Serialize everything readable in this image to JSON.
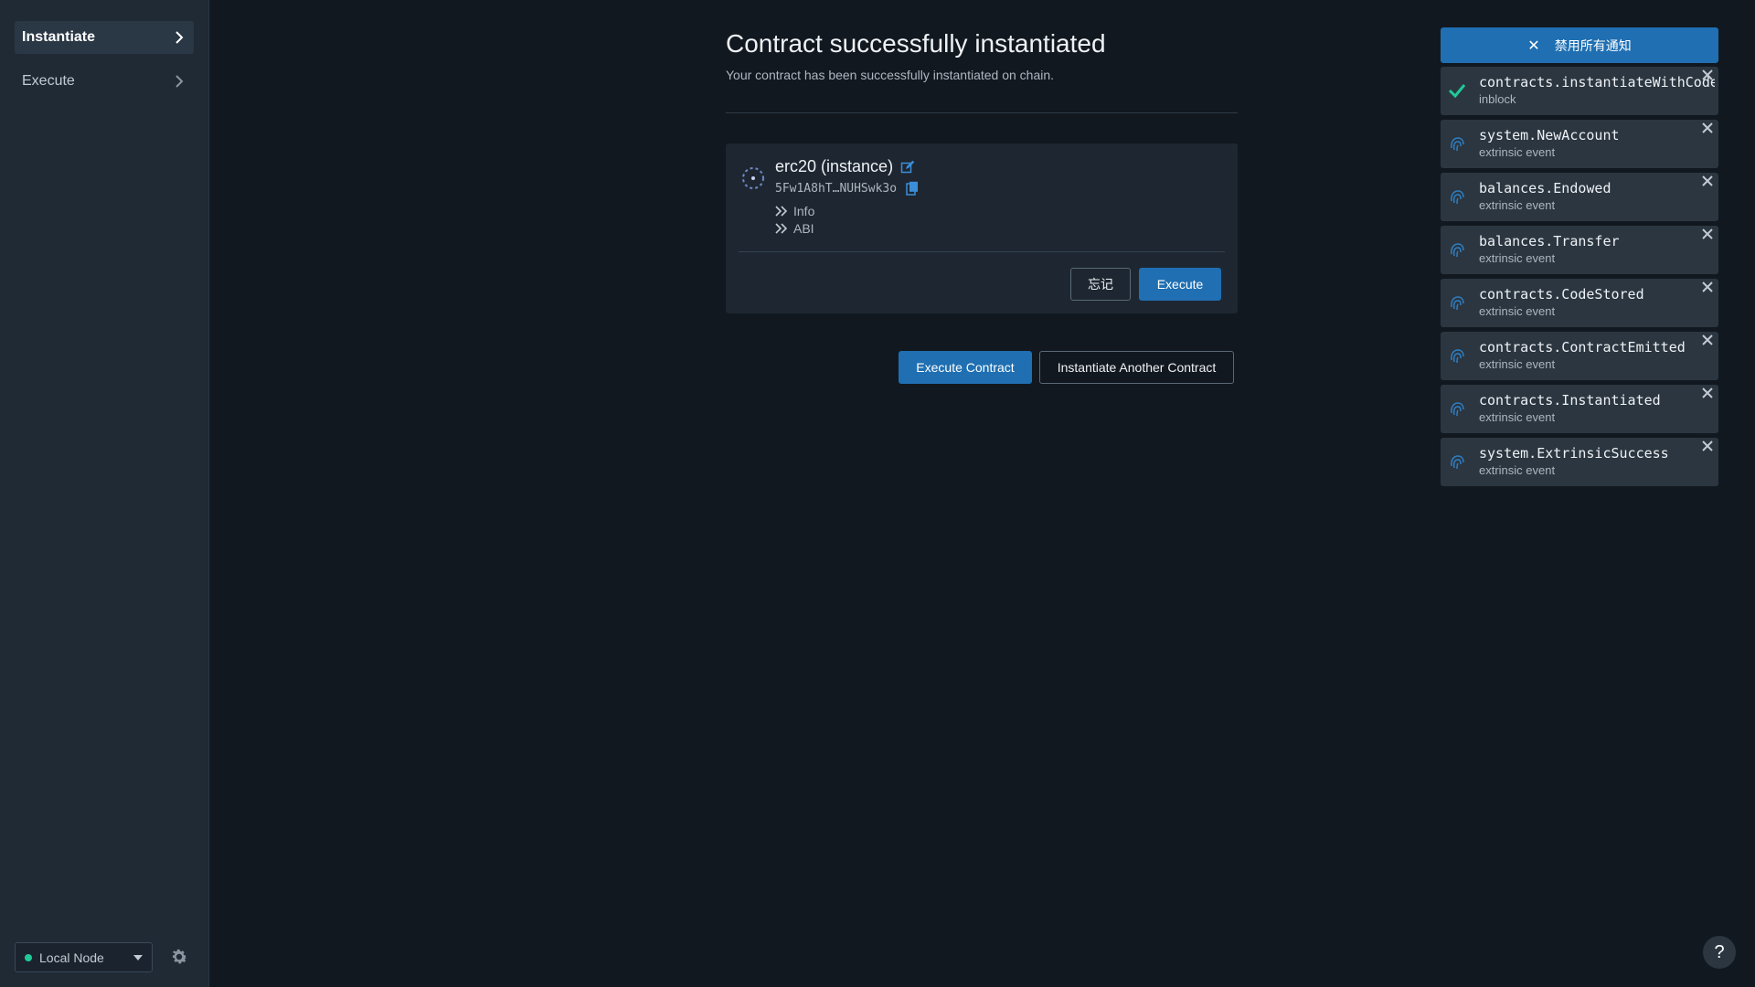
{
  "sidebar": {
    "items": [
      {
        "label": "Instantiate",
        "active": true
      },
      {
        "label": "Execute",
        "active": false
      }
    ],
    "node_selector": {
      "label": "Local Node",
      "status_color": "#20c997"
    }
  },
  "main": {
    "title": "Contract successfully instantiated",
    "subtitle": "Your contract has been successfully instantiated on chain.",
    "contract": {
      "name": "erc20 (instance)",
      "address": "5Fw1A8hT…NUHSwk3o",
      "links": [
        "Info",
        "ABI"
      ],
      "forget_label": "忘记",
      "execute_label": "Execute"
    },
    "actions": {
      "execute_contract_label": "Execute Contract",
      "instantiate_another_label": "Instantiate Another Contract"
    }
  },
  "notifications": {
    "dismiss_all_label": "禁用所有通知",
    "items": [
      {
        "title": "contracts.instantiateWithCode",
        "subtitle": "inblock",
        "icon": "check-icon"
      },
      {
        "title": "system.NewAccount",
        "subtitle": "extrinsic event",
        "icon": "fingerprint-icon"
      },
      {
        "title": "balances.Endowed",
        "subtitle": "extrinsic event",
        "icon": "fingerprint-icon"
      },
      {
        "title": "balances.Transfer",
        "subtitle": "extrinsic event",
        "icon": "fingerprint-icon"
      },
      {
        "title": "contracts.CodeStored",
        "subtitle": "extrinsic event",
        "icon": "fingerprint-icon"
      },
      {
        "title": "contracts.ContractEmitted",
        "subtitle": "extrinsic event",
        "icon": "fingerprint-icon"
      },
      {
        "title": "contracts.Instantiated",
        "subtitle": "extrinsic event",
        "icon": "fingerprint-icon"
      },
      {
        "title": "system.ExtrinsicSuccess",
        "subtitle": "extrinsic event",
        "icon": "fingerprint-icon"
      }
    ]
  },
  "help_label": "?",
  "colors": {
    "accent": "#1f6fb2",
    "success": "#20c997",
    "background": "#12181f",
    "sidebar": "#1f2a35"
  }
}
